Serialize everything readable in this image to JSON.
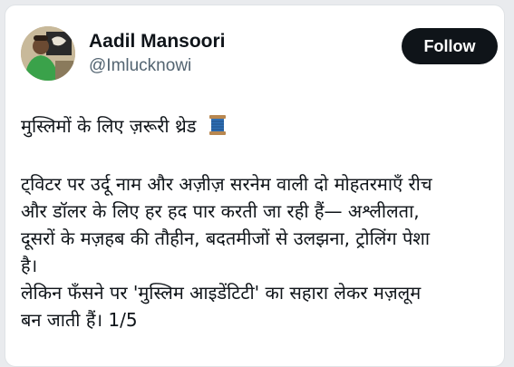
{
  "author": {
    "name": "Aadil Mansoori",
    "handle": "@Imlucknowi"
  },
  "follow_button": {
    "label": "Follow"
  },
  "tweet": {
    "heading": "मुस्लिमों के लिए ज़रूरी थ्रेड",
    "heading_emoji": "thread-spool-icon",
    "lines": [
      "ट्विटर पर उर्दू नाम और अज़ीज़ सरनेम वाली दो मोहतरमाएँ रीच",
      "और डॉलर के लिए हर हद पार करती जा रही हैं— अश्लीलता,",
      "दूसरों के मज़हब की तौहीन, बदतमीजों से उलझना, ट्रोलिंग पेशा",
      "है।",
      "लेकिन फँसने पर 'मुस्लिम आइडेंटिटी' का सहारा लेकर मज़लूम",
      "बन जाती हैं। 1/5"
    ]
  },
  "colors": {
    "text": "#0f1419",
    "secondary": "#536471",
    "follow_bg": "#0f1419",
    "follow_text": "#ffffff"
  }
}
